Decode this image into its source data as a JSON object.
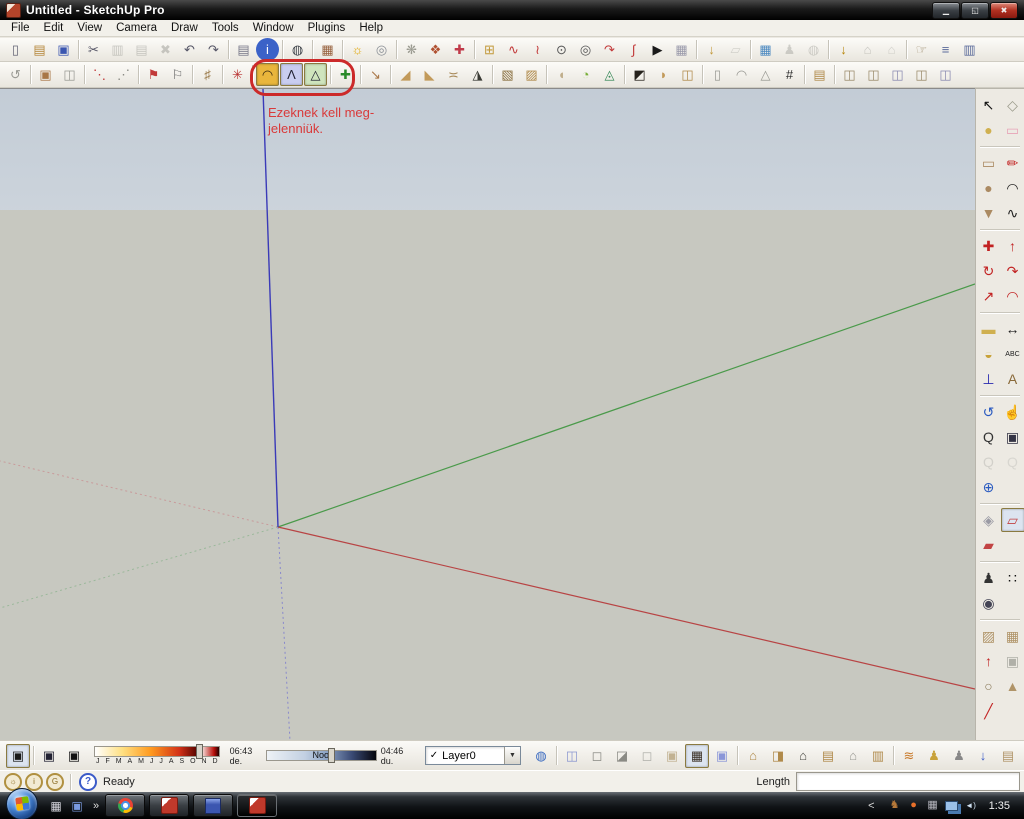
{
  "window": {
    "title": "Untitled - SketchUp Pro",
    "controls": [
      {
        "n": "minimize-button",
        "g": "▁"
      },
      {
        "n": "restore-button",
        "g": "◱"
      },
      {
        "n": "close-button",
        "g": "✖"
      }
    ]
  },
  "menu": {
    "items": [
      "File",
      "Edit",
      "View",
      "Camera",
      "Draw",
      "Tools",
      "Window",
      "Plugins",
      "Help"
    ]
  },
  "toolbar1": {
    "groups": [
      [
        {
          "n": "new-document",
          "g": "▯",
          "c": "#667"
        },
        {
          "n": "open-model",
          "g": "▤",
          "c": "#b5863a"
        },
        {
          "n": "save-model",
          "g": "▣",
          "c": "#3b56b0"
        }
      ],
      [
        {
          "n": "cut-tool",
          "g": "✂",
          "c": "#556"
        },
        {
          "n": "copy-tool",
          "g": "▥",
          "c": "#9a9a94",
          "d": true
        },
        {
          "n": "paste-tool",
          "g": "▤",
          "c": "#9a9a94",
          "d": true
        },
        {
          "n": "erase-tool",
          "g": "✖",
          "c": "#9a9a94",
          "d": true
        },
        {
          "n": "undo-button",
          "g": "↶",
          "c": "#556"
        },
        {
          "n": "redo-button",
          "g": "↷",
          "c": "#556"
        }
      ],
      [
        {
          "n": "print-button",
          "g": "▤",
          "c": "#778"
        },
        {
          "n": "model-info-button",
          "g": "i",
          "c": "#fff",
          "b": "#3b62c8",
          "r": true
        }
      ],
      [
        {
          "n": "send-to-layout",
          "g": "◍",
          "c": "#3a3f46"
        }
      ],
      [
        {
          "n": "styles-browser",
          "g": "▦",
          "c": "#96603c"
        }
      ],
      [
        {
          "n": "shadows-bulb",
          "g": "☼",
          "c": "#e0a500"
        },
        {
          "n": "preview-render",
          "g": "◎",
          "c": "#8a8f96"
        }
      ],
      [
        {
          "n": "gear-tool",
          "g": "❋",
          "c": "#9a9a90"
        },
        {
          "n": "pins-palette",
          "g": "❖",
          "c": "#b05030"
        },
        {
          "n": "pin-tool",
          "g": "✚",
          "c": "#c03a4a"
        }
      ],
      [
        {
          "n": "add-scene",
          "g": "⊞",
          "c": "#c2993a"
        },
        {
          "n": "bezier-curve-tool",
          "g": "∿",
          "c": "#c23a3a"
        },
        {
          "n": "bezier-edit-tool",
          "g": "≀",
          "c": "#c23a3a"
        },
        {
          "n": "circle-center-tool",
          "g": "⊙",
          "c": "#555"
        },
        {
          "n": "concentric-circles-tool",
          "g": "◎",
          "c": "#555"
        },
        {
          "n": "arc-arrow-tool",
          "g": "↷",
          "c": "#c23a3a"
        },
        {
          "n": "spline-tool",
          "g": "∫",
          "c": "#c23a3a"
        },
        {
          "n": "play-animation",
          "g": "▶",
          "c": "#1a1a1a"
        },
        {
          "n": "calculator-tool",
          "g": "▦",
          "c": "#99a"
        }
      ],
      [
        {
          "n": "import-collection",
          "g": "↓",
          "c": "#c2993a"
        },
        {
          "n": "polygon-gray-tool",
          "g": "▱",
          "c": "#b4b4ae",
          "d": true
        }
      ],
      [
        {
          "n": "photo-texture-tool",
          "g": "▦",
          "c": "#4a88c0"
        },
        {
          "n": "figure-tool",
          "g": "♟",
          "c": "#a8a8a2",
          "d": true
        },
        {
          "n": "globe-tool",
          "g": "◍",
          "c": "#a8a8a2",
          "d": true
        }
      ],
      [
        {
          "n": "import-model",
          "g": "↓",
          "c": "#b8860b"
        },
        {
          "n": "house-front-tool",
          "g": "⌂",
          "c": "#9a9a94",
          "d": true
        },
        {
          "n": "house-iso-tool",
          "g": "⌂",
          "c": "#b0b0aa",
          "d": true
        }
      ],
      [
        {
          "n": "interact-hand-tool",
          "g": "☞",
          "c": "#9a8a6a"
        },
        {
          "n": "component-options",
          "g": "≡",
          "c": "#5a6a9a"
        },
        {
          "n": "component-attributes",
          "g": "▥",
          "c": "#5a6a9a"
        }
      ]
    ]
  },
  "toolbar2": {
    "groups": [
      [
        {
          "n": "offset-arrow-tool",
          "g": "↺",
          "c": "#9a9a94"
        }
      ],
      [
        {
          "n": "solid-tools-a",
          "g": "▣",
          "c": "#a87646"
        },
        {
          "n": "solid-tools-b",
          "g": "◫",
          "c": "#9a9a94"
        }
      ],
      [
        {
          "n": "curve-dots-tool",
          "g": "⋱",
          "c": "#c23a3a"
        },
        {
          "n": "line-dots-tool",
          "g": "⋰",
          "c": "#8a8a84"
        }
      ],
      [
        {
          "n": "flag-red-tool",
          "g": "⚑",
          "c": "#c23a3a"
        },
        {
          "n": "flag-white-tool",
          "g": "⚐",
          "c": "#666"
        }
      ],
      [
        {
          "n": "fence-tool",
          "g": "♯",
          "c": "#9a7a4a"
        }
      ],
      [
        {
          "n": "compass-star-tool",
          "g": "✳",
          "c": "#b83030"
        }
      ],
      [
        {
          "n": "soap-skin-dome-tool",
          "g": "◠",
          "c": "#3a2a10",
          "b": "#e9b63c",
          "a": true
        },
        {
          "n": "soap-skin-tent-tool",
          "g": "Λ",
          "c": "#223",
          "b": "#c9cdf0",
          "a": true
        },
        {
          "n": "soap-skin-bubble-tool",
          "g": "△",
          "c": "#223",
          "b": "#cfe4bd",
          "a": true
        }
      ],
      [
        {
          "n": "add-location-tool",
          "g": "✚",
          "c": "#2a8a2a"
        }
      ],
      [
        {
          "n": "export-box-tool",
          "g": "↘",
          "c": "#a87646"
        }
      ],
      [
        {
          "n": "ramp-up-tool",
          "g": "◢",
          "c": "#c29a5a"
        },
        {
          "n": "ramp-down-tool",
          "g": "◣",
          "c": "#c29a5a"
        },
        {
          "n": "bone-tool",
          "g": "≍",
          "c": "#a88a5a"
        },
        {
          "n": "wedge-dark-tool",
          "g": "◮",
          "c": "#3a3a34"
        }
      ],
      [
        {
          "n": "multi-face-cube-tool",
          "g": "▧",
          "c": "#8a7040"
        },
        {
          "n": "fold-tool",
          "g": "▨",
          "c": "#b08a4a"
        }
      ],
      [
        {
          "n": "shell-tool",
          "g": "◖",
          "c": "#c0ae8c"
        },
        {
          "n": "shape-balloon-tool",
          "g": "◔",
          "c": "#7ab03a"
        },
        {
          "n": "wire-dome-tool",
          "g": "◬",
          "c": "#3a8a5a"
        }
      ],
      [
        {
          "n": "frame-dark-tool",
          "g": "◩",
          "c": "#26221c"
        },
        {
          "n": "fan-fold-tool",
          "g": "◗",
          "c": "#c29a5a"
        },
        {
          "n": "bend-box-tool",
          "g": "◫",
          "c": "#b08a4a"
        }
      ],
      [
        {
          "n": "column-tool",
          "g": "▯",
          "c": "#9a9a94"
        },
        {
          "n": "arc-wall-tool",
          "g": "◠",
          "c": "#9a9a94"
        },
        {
          "n": "cone-tool",
          "g": "△",
          "c": "#9a9a94"
        },
        {
          "n": "grid-tool",
          "g": "#",
          "c": "#2a2a2a"
        }
      ],
      [
        {
          "n": "stack-boxes-tool",
          "g": "▤",
          "c": "#b08a4a"
        }
      ],
      [
        {
          "n": "align-tool-a",
          "g": "◫",
          "c": "#9a8a6a"
        },
        {
          "n": "align-tool-b",
          "g": "◫",
          "c": "#9a8a6a"
        },
        {
          "n": "align-tool-c",
          "g": "◫",
          "c": "#8a8ab0"
        },
        {
          "n": "align-tool-d",
          "g": "◫",
          "c": "#9a8a6a"
        },
        {
          "n": "align-tool-e",
          "g": "◫",
          "c": "#8a8ab0"
        }
      ]
    ]
  },
  "annotation": {
    "line1": "Ezeknek kell meg-",
    "line2": "jelenniük.",
    "color": "#cc2a2a"
  },
  "viewport": {
    "axis_colors": {
      "blue": "#3a3ab8",
      "green": "#4a9a4a",
      "red": "#b84444",
      "blue_dash": "#8888cc",
      "green_dash": "#9ab89a",
      "red_dash": "#c89a9a"
    },
    "sky_top": "#c3ccd6",
    "sky_bottom": "#eef0ef",
    "ground": "#c7c8c0"
  },
  "sidebar": {
    "groups": [
      [
        {
          "n": "select-tool",
          "g": "↖",
          "c": "#111"
        },
        {
          "n": "make-component-tool",
          "g": "◇",
          "c": "#9a9a8a"
        },
        {
          "n": "paint-bucket-tool",
          "g": "●",
          "c": "#d0b050"
        },
        {
          "n": "eraser-tool",
          "g": "▭",
          "c": "#e8a4b8"
        }
      ],
      [
        {
          "n": "rectangle-tool",
          "g": "▭",
          "c": "#ab8a62"
        },
        {
          "n": "line-tool",
          "g": "✏",
          "c": "#c22222"
        },
        {
          "n": "circle-tool",
          "g": "●",
          "c": "#ab8a62"
        },
        {
          "n": "arc-tool",
          "g": "◠",
          "c": "#222"
        },
        {
          "n": "polygon-tool",
          "g": "▼",
          "c": "#ab8a62"
        },
        {
          "n": "freehand-tool",
          "g": "∿",
          "c": "#222"
        }
      ],
      [
        {
          "n": "move-tool",
          "g": "✚",
          "c": "#c22222"
        },
        {
          "n": "push-pull-tool",
          "g": "↑",
          "c": "#c22222"
        },
        {
          "n": "rotate-tool",
          "g": "↻",
          "c": "#c22222"
        },
        {
          "n": "follow-me-tool",
          "g": "↷",
          "c": "#c22222"
        },
        {
          "n": "scale-tool",
          "g": "↗",
          "c": "#c22222"
        },
        {
          "n": "offset-tool",
          "g": "◠",
          "c": "#c22222"
        }
      ],
      [
        {
          "n": "tape-measure-tool",
          "g": "▬",
          "c": "#d0b050"
        },
        {
          "n": "dimension-tool",
          "g": "↔",
          "c": "#222"
        },
        {
          "n": "protractor-tool",
          "g": "◒",
          "c": "#c8a23a"
        },
        {
          "n": "text-tool",
          "g": "ABC",
          "c": "#222",
          "fs": 7
        },
        {
          "n": "axes-tool",
          "g": "⊥",
          "c": "#2a2ab0"
        },
        {
          "n": "threed-text-tool",
          "g": "A",
          "c": "#8a6a3a"
        }
      ],
      [
        {
          "n": "orbit-tool",
          "g": "↺",
          "c": "#2a5ac0"
        },
        {
          "n": "pan-tool",
          "g": "☝",
          "c": "#b89a6a"
        },
        {
          "n": "zoom-tool",
          "g": "Q",
          "c": "#333"
        },
        {
          "n": "zoom-window-tool",
          "g": "▣",
          "c": "#334"
        },
        {
          "n": "zoom-previous",
          "g": "Q",
          "c": "#b8b8b2",
          "d": true
        },
        {
          "n": "zoom-next",
          "g": "Q",
          "c": "#c4c4be",
          "d": true
        },
        {
          "n": "zoom-extents",
          "g": "⊕",
          "c": "#2a5ac0"
        },
        null
      ],
      [
        {
          "n": "section-plane-tool",
          "g": "◈",
          "c": "#9a9aa4"
        },
        {
          "n": "display-section-planes",
          "g": "▱",
          "c": "#c24444",
          "a": true
        },
        {
          "n": "display-section-cuts",
          "g": "▰",
          "c": "#c24444"
        },
        null
      ],
      [
        {
          "n": "position-camera-tool",
          "g": "♟",
          "c": "#333"
        },
        {
          "n": "walk-tool",
          "g": "∷",
          "c": "#111"
        },
        {
          "n": "look-around-tool",
          "g": "◉",
          "c": "#445"
        },
        null
      ],
      [
        {
          "n": "sandbox-from-contours",
          "g": "▨",
          "c": "#b09468"
        },
        {
          "n": "sandbox-from-scratch",
          "g": "▦",
          "c": "#b09468"
        },
        {
          "n": "smoove-tool",
          "g": "↑",
          "c": "#c22222"
        },
        {
          "n": "stamp-tool",
          "g": "▣",
          "c": "#b0b0a8"
        },
        {
          "n": "drape-tool",
          "g": "○",
          "c": "#8a7a5a"
        },
        {
          "n": "add-detail-tool",
          "g": "▲",
          "c": "#b09468"
        },
        {
          "n": "flip-edge-tool",
          "g": "╱",
          "c": "#c22222"
        },
        null
      ]
    ]
  },
  "bottom": {
    "left_groups": [
      [
        {
          "n": "shadow-settings-dialog",
          "g": "▣",
          "c": "#1a1a1a",
          "a": true
        }
      ],
      [
        {
          "n": "shadow-date-toggle",
          "g": "▣",
          "c": "#223"
        },
        {
          "n": "shadow-time-toggle",
          "g": "▣",
          "c": "#111"
        }
      ]
    ],
    "months": [
      "J",
      "F",
      "M",
      "A",
      "M",
      "J",
      "J",
      "A",
      "S",
      "O",
      "N",
      "D"
    ],
    "time_start": "06:43 de.",
    "noon": "Noon",
    "time_end": "04:46 du.",
    "right_groups": [
      [
        {
          "n": "layers-info-globe",
          "g": "◍",
          "c": "#3a6ac0"
        }
      ],
      [
        {
          "n": "face-style-xray",
          "g": "◫",
          "c": "#8a96d0"
        },
        {
          "n": "face-style-wireframe",
          "g": "◻",
          "c": "#8a8a84"
        },
        {
          "n": "face-style-back-edges",
          "g": "◪",
          "c": "#8a8a84"
        },
        {
          "n": "face-style-hidden-line",
          "g": "◻",
          "c": "#b0b0aa"
        },
        {
          "n": "face-style-shaded",
          "g": "▣",
          "c": "#c2b292"
        },
        {
          "n": "face-style-textured",
          "g": "▦",
          "c": "#3a2f24",
          "a": true
        },
        {
          "n": "face-style-monochrome",
          "g": "▣",
          "c": "#8a96d8"
        }
      ],
      [
        {
          "n": "view-iso",
          "g": "⌂",
          "c": "#b08a4a"
        },
        {
          "n": "view-top",
          "g": "◨",
          "c": "#b08a4a"
        },
        {
          "n": "view-front",
          "g": "⌂",
          "c": "#4a4a44"
        },
        {
          "n": "view-right",
          "g": "▤",
          "c": "#b08a4a"
        },
        {
          "n": "view-back",
          "g": "⌂",
          "c": "#9a9a94"
        },
        {
          "n": "view-left",
          "g": "▥",
          "c": "#b08a4a"
        }
      ],
      [
        {
          "n": "plugin-pipes-tool",
          "g": "≋",
          "c": "#c87a2a"
        },
        {
          "n": "plugin-figure-a",
          "g": "♟",
          "c": "#c8a23a"
        },
        {
          "n": "plugin-figure-b",
          "g": "♟",
          "c": "#888"
        }
      ]
    ],
    "corner_group": [
      [
        {
          "n": "corner-tool-a",
          "g": "↓",
          "c": "#3a5ac8"
        },
        {
          "n": "corner-tool-b",
          "g": "▤",
          "c": "#b09468"
        }
      ]
    ]
  },
  "layers": {
    "check": "✓",
    "selected": "Layer0",
    "arrow": "▼"
  },
  "statusbar": {
    "coins": [
      [
        {
          "n": "status-coin-bulb",
          "g": "☼",
          "c": "#8a6a20"
        },
        {
          "n": "status-coin-credit",
          "g": "i",
          "c": "#8a6a20"
        },
        {
          "n": "status-coin-google",
          "g": "G",
          "c": "#8a6a20"
        }
      ]
    ],
    "help_glyph": "?",
    "ready": "Ready",
    "length_label": "Length",
    "length_value": ""
  },
  "taskbar": {
    "quicklaunch": [
      [
        {
          "n": "quicklaunch-calculator",
          "g": "▦",
          "c": "#d8d8e0"
        },
        {
          "n": "quicklaunch-floppy",
          "g": "▣",
          "c": "#7a9ae0"
        }
      ]
    ],
    "ql_chevron": "»",
    "buttons": [
      {
        "n": "task-chrome",
        "k": "chrome"
      },
      {
        "n": "task-sketchup-1",
        "k": "su"
      },
      {
        "n": "task-floppy-app",
        "k": "floppy"
      },
      {
        "n": "task-sketchup-2",
        "k": "su",
        "active": true
      }
    ],
    "tray_chevron": "<",
    "tray": [
      [
        {
          "n": "tray-app-a",
          "g": "♞",
          "c": "#b87a3a"
        },
        {
          "n": "tray-app-b",
          "g": "●",
          "c": "#e8702a"
        },
        {
          "n": "tray-keyboard",
          "g": "▦",
          "c": "#b8b8c0"
        },
        {
          "n": "tray-network",
          "k": "net"
        },
        {
          "n": "tray-volume",
          "g": "◄)",
          "c": "#cfe0f0",
          "fs": 8
        }
      ]
    ],
    "clock": "1:35"
  }
}
